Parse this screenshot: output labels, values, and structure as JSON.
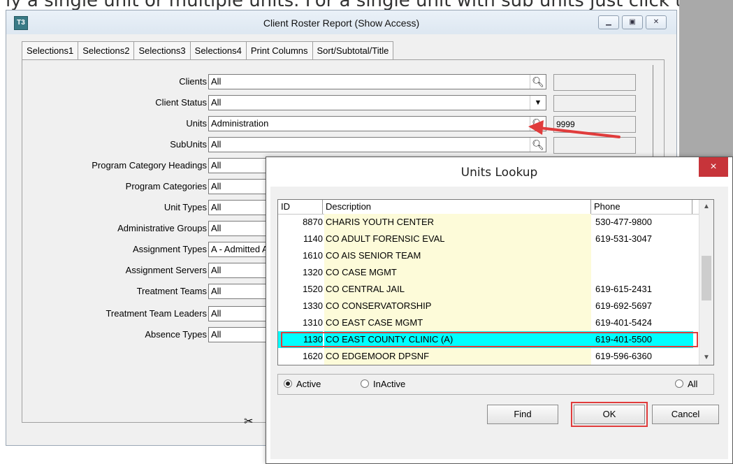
{
  "top_caption": "ly a single unit or multiple units. For a single unit with sub units just click the lookup",
  "main_window": {
    "title": "Client Roster Report (Show Access)",
    "app_icon": "T3",
    "controls": [
      "minimize-icon",
      "restore-icon",
      "close-icon"
    ]
  },
  "tabs": [
    {
      "label": "Selections1"
    },
    {
      "label": "Selections2"
    },
    {
      "label": "Selections3"
    },
    {
      "label": "Selections4"
    },
    {
      "label": "Print Columns"
    },
    {
      "label": "Sort/Subtotal/Title"
    }
  ],
  "fields": [
    {
      "label": "Clients",
      "value": "All",
      "control": "lookup"
    },
    {
      "label": "Client Status",
      "value": "All",
      "control": "dropdown"
    },
    {
      "label": "Units",
      "value": "Administration",
      "control": "lookup",
      "side_value": "9999"
    },
    {
      "label": "SubUnits",
      "value": "All",
      "control": "lookup"
    },
    {
      "label": "Program Category Headings",
      "value": "All"
    },
    {
      "label": "Program Categories",
      "value": "All"
    },
    {
      "label": "Unit Types",
      "value": "All"
    },
    {
      "label": "Administrative Groups",
      "value": "All"
    },
    {
      "label": "Assignment Types",
      "value": "A - Admitted As"
    },
    {
      "label": "Assignment Servers",
      "value": "All"
    },
    {
      "label": "Treatment Teams",
      "value": "All"
    },
    {
      "label": "Treatment Team Leaders",
      "value": "All"
    },
    {
      "label": "Absence Types",
      "value": "All"
    }
  ],
  "dialog": {
    "title": "Units Lookup",
    "close": "×",
    "columns": {
      "id": "ID",
      "description": "Description",
      "phone": "Phone"
    },
    "rows": [
      {
        "id": "8870",
        "description": "CHARIS YOUTH CENTER",
        "phone": "530-477-9800"
      },
      {
        "id": "1140",
        "description": "CO ADULT FORENSIC EVAL",
        "phone": "619-531-3047"
      },
      {
        "id": "1610",
        "description": "CO AIS SENIOR TEAM",
        "phone": ""
      },
      {
        "id": "1320",
        "description": "CO CASE MGMT",
        "phone": ""
      },
      {
        "id": "1520",
        "description": "CO CENTRAL JAIL",
        "phone": "619-615-2431"
      },
      {
        "id": "1330",
        "description": "CO CONSERVATORSHIP",
        "phone": "619-692-5697"
      },
      {
        "id": "1310",
        "description": "CO EAST CASE MGMT",
        "phone": "619-401-5424"
      },
      {
        "id": "1130",
        "description": "CO EAST COUNTY CLINIC (A)",
        "phone": "619-401-5500",
        "selected": true
      },
      {
        "id": "1620",
        "description": "CO EDGEMOOR DPSNF",
        "phone": "619-596-6360"
      }
    ],
    "filter": {
      "active": "Active",
      "inactive": "InActive",
      "all": "All",
      "selected": "Active"
    },
    "buttons": {
      "find": "Find",
      "ok": "OK",
      "cancel": "Cancel"
    }
  },
  "colors": {
    "highlight_row": "#00ffff",
    "annotation_red": "#e03c3c",
    "description_bg": "#fdfbd9",
    "dialog_close": "#c7343a"
  }
}
